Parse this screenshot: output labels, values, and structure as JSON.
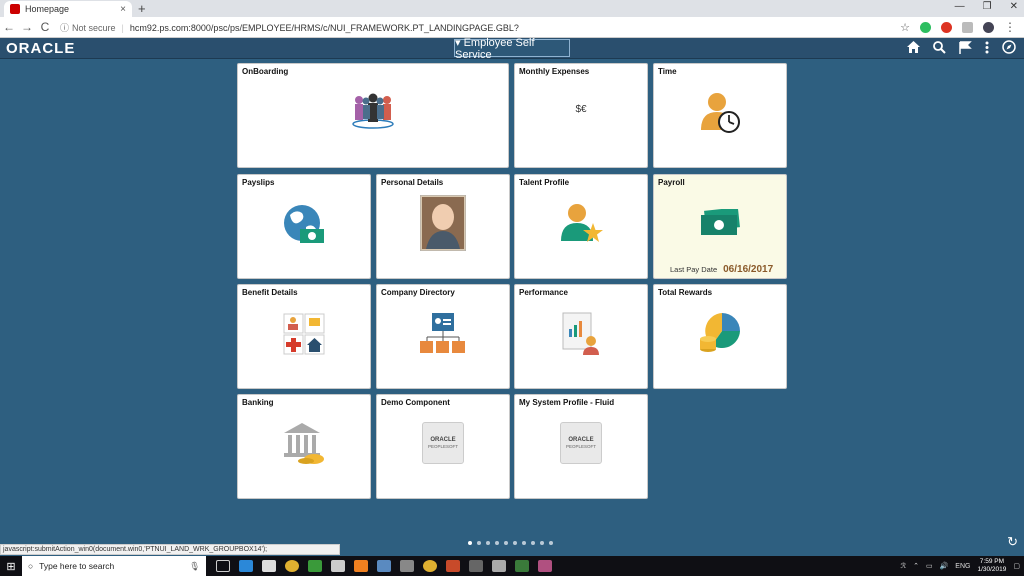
{
  "browser": {
    "tab_title": "Homepage",
    "tab_close": "×",
    "new_tab": "+",
    "win_min": "—",
    "win_restore": "❐",
    "win_close": "✕",
    "back": "←",
    "forward": "→",
    "reload": "C",
    "not_secure": "Not secure",
    "url": "hcm92.ps.com:8000/psc/ps/EMPLOYEE/HRMS/c/NUI_FRAMEWORK.PT_LANDINGPAGE.GBL?",
    "star": "☆",
    "menu": "⋮"
  },
  "header": {
    "logo": "ORACLE",
    "homepage": "▾ Employee Self Service"
  },
  "tiles": {
    "onboarding": "OnBoarding",
    "monthly_expenses": "Monthly Expenses",
    "time": "Time",
    "payslips": "Payslips",
    "personal_details": "Personal Details",
    "talent_profile": "Talent Profile",
    "payroll": "Payroll",
    "payroll_last_pay_label": "Last Pay Date",
    "payroll_last_pay_date": "06/16/2017",
    "benefit_details": "Benefit Details",
    "company_directory": "Company Directory",
    "performance": "Performance",
    "total_rewards": "Total Rewards",
    "banking": "Banking",
    "demo_component": "Demo Component",
    "my_system_profile": "My System Profile - Fluid",
    "badge_oracle": "ORACLE",
    "badge_peoplesoft": "PEOPLESOFT"
  },
  "status_bar": "javascript:submitAction_win0(document.win0,'PTNUI_LAND_WRK_GROUPBOX14');",
  "taskbar": {
    "search_placeholder": "Type here to search",
    "lang": "ENG",
    "time": "7:59 PM",
    "date": "1/30/2019"
  },
  "colors": {
    "page_bg": "#2e5f80",
    "header_bg": "#2a4f6e",
    "payroll_bg": "#fafae6",
    "payroll_date": "#8a5a2a"
  }
}
